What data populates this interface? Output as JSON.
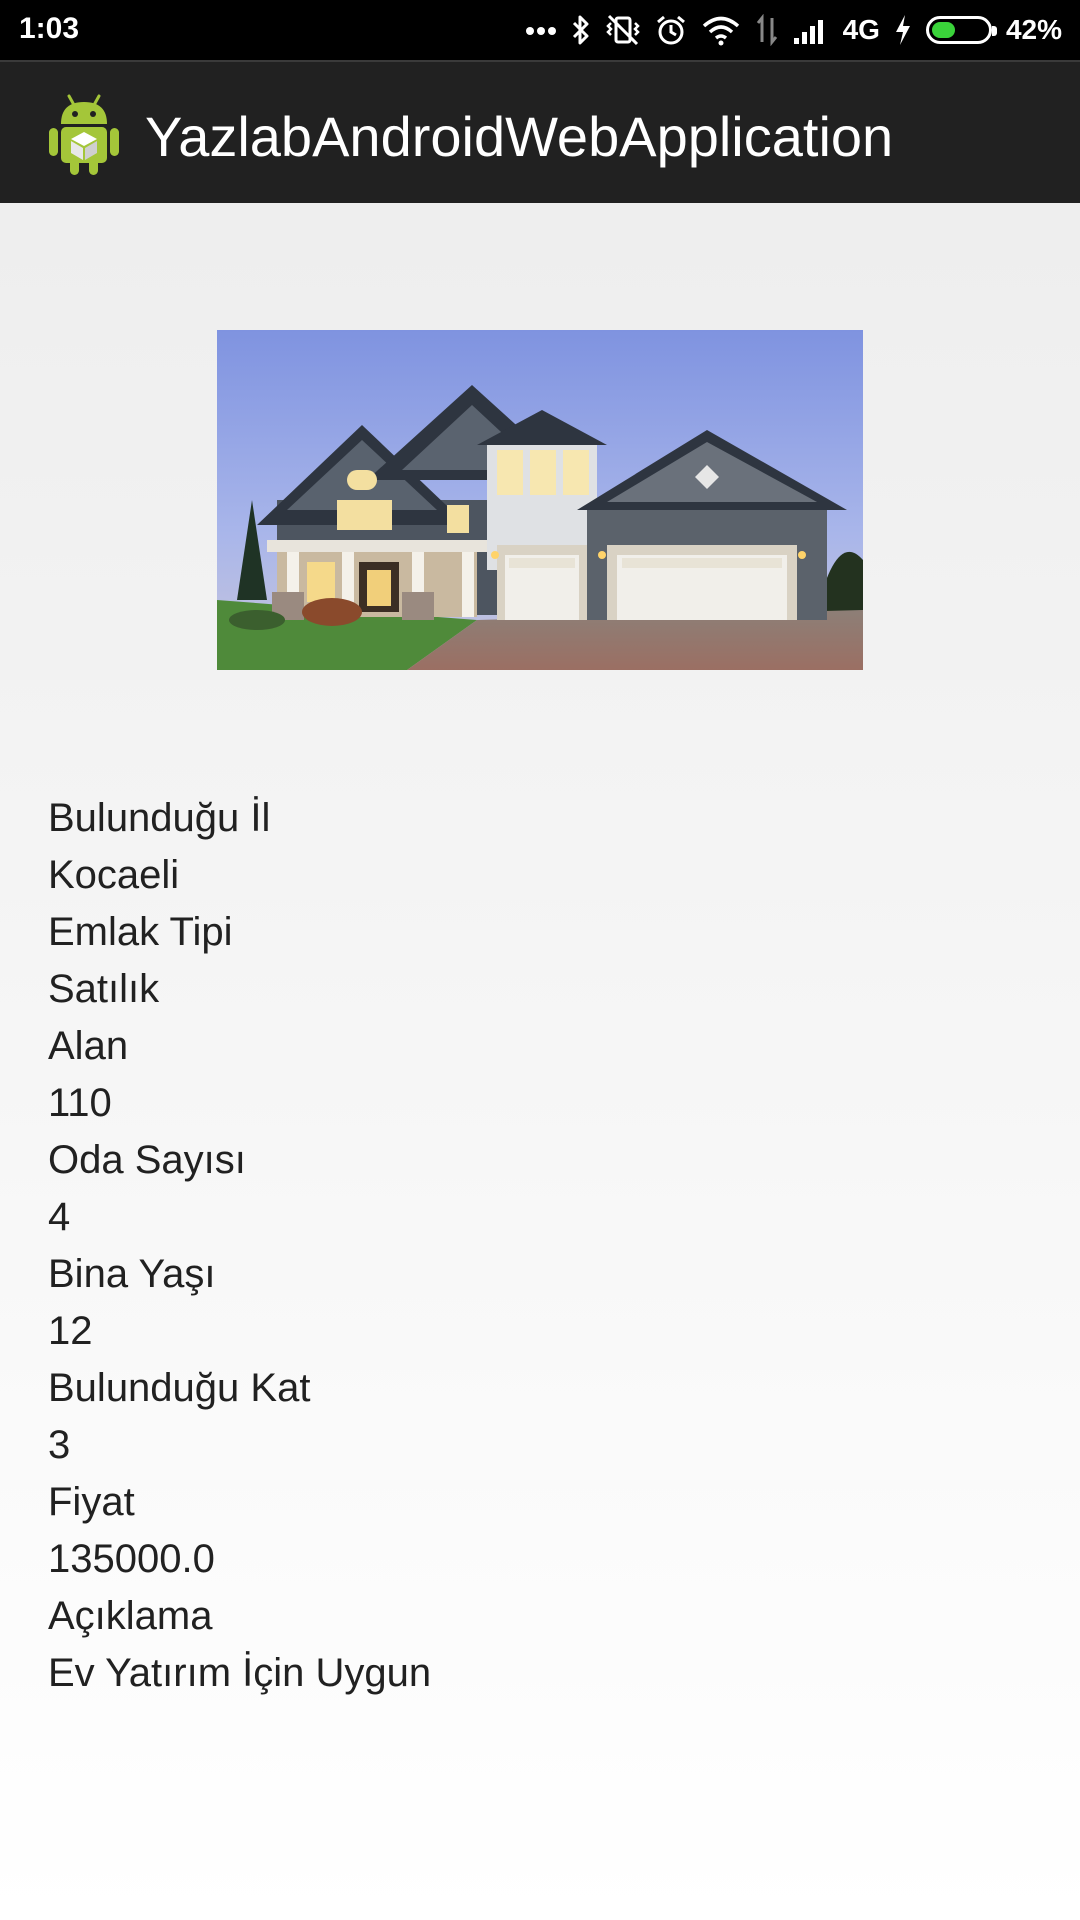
{
  "status_bar": {
    "time": "1:03",
    "network": "4G",
    "battery_percent_text": "42%",
    "battery_level": 0.42,
    "icons": [
      "more-icon",
      "bluetooth-icon",
      "vibrate-off-icon",
      "alarm-icon",
      "wifi-icon",
      "data-arrows-icon",
      "signal-icon",
      "charging-icon",
      "battery-icon"
    ]
  },
  "app_bar": {
    "title": "YazlabAndroidWebApplication",
    "icon": "android-app-icon",
    "icon_color": "#a4c639"
  },
  "property": {
    "photo": "house-photo",
    "details": [
      {
        "label": "Bulunduğu İl",
        "value": "Kocaeli"
      },
      {
        "label": "Emlak Tipi",
        "value": "Satılık"
      },
      {
        "label": "Alan",
        "value": "110"
      },
      {
        "label": "Oda Sayısı",
        "value": "4"
      },
      {
        "label": "Bina Yaşı",
        "value": "12"
      },
      {
        "label": "Bulunduğu Kat",
        "value": "3"
      },
      {
        "label": "Fiyat",
        "value": "135000.0"
      },
      {
        "label": "Açıklama",
        "value": "Ev Yatırım İçin Uygun"
      }
    ]
  },
  "colors": {
    "status_bar_bg": "#000000",
    "app_bar_bg": "#212121",
    "text": "#212121",
    "battery_fill": "#3ad33a"
  }
}
